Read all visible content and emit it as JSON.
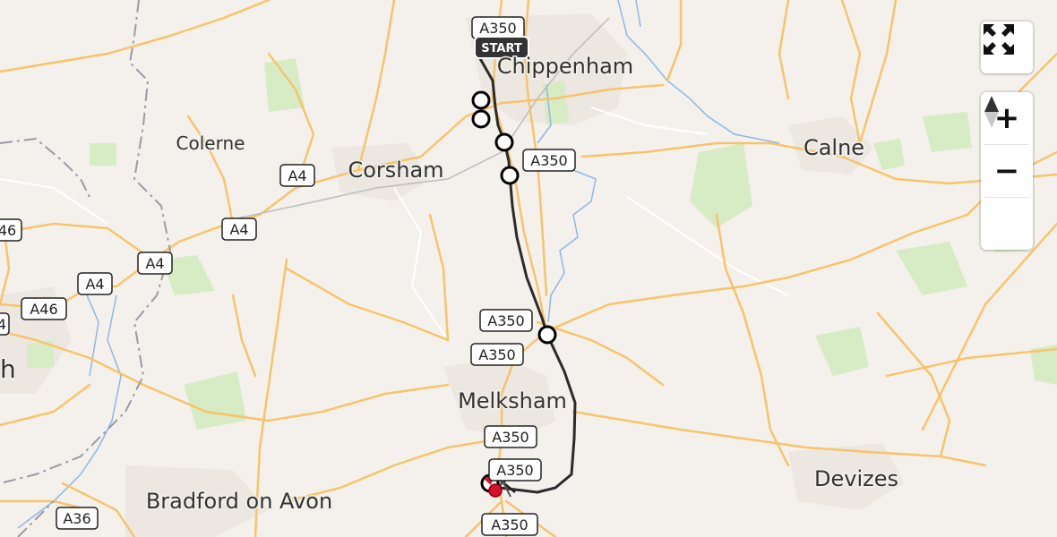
{
  "map": {
    "places": {
      "chippenham": "Chippenham",
      "colerne": "Colerne",
      "corsham": "Corsham",
      "calne": "Calne",
      "melksham": "Melksham",
      "devizes": "Devizes",
      "bradford": "Bradford on Avon",
      "edge_left": "h"
    },
    "roads": {
      "a350_1": "A350",
      "a350_2": "A350",
      "a350_3": "A350",
      "a350_4": "A350",
      "a350_5": "A350",
      "a350_6": "A350",
      "a350_7": "A350",
      "a4_1": "A4",
      "a4_2": "A4",
      "a4_3": "A4",
      "a4_4": "A4",
      "a46_1": "A46",
      "a46_2": "46",
      "a36": "A36",
      "edge_4": "4"
    },
    "route": {
      "start_label": "START",
      "color": "#2b2b2b"
    },
    "colors": {
      "background": "#f4f1ec",
      "major_road": "#f7c46a",
      "boundary": "#9a9aa8",
      "water": "#8fb6e8",
      "park": "#d7ebc5",
      "end_marker": "#d8112b"
    }
  },
  "controls": {
    "fullscreen": "fullscreen-icon",
    "zoom_in": "+",
    "zoom_out": "−",
    "compass": "compass-icon"
  }
}
